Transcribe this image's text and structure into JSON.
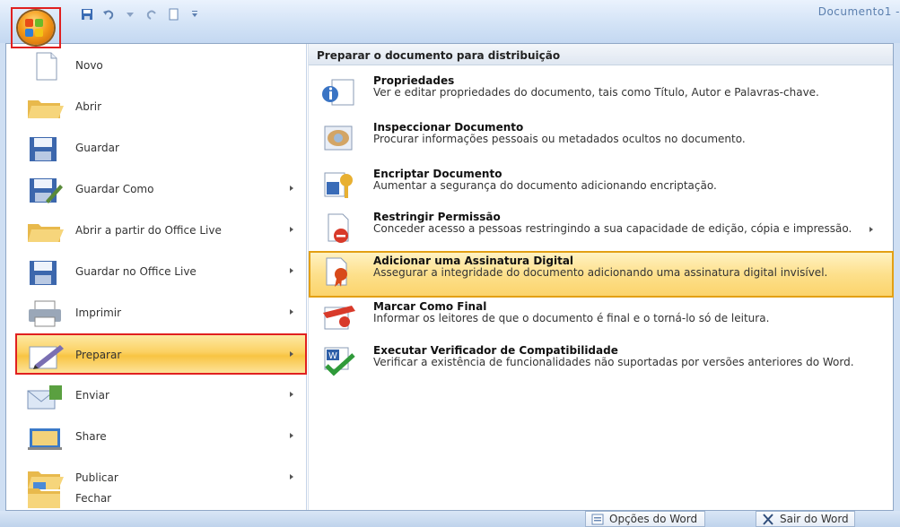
{
  "window": {
    "title": "Documento1 -"
  },
  "left_menu": [
    {
      "label": "Novo",
      "icon": "new-document-icon",
      "submenu": false
    },
    {
      "label": "Abrir",
      "icon": "open-folder-icon",
      "submenu": false
    },
    {
      "label": "Guardar",
      "icon": "save-disk-icon",
      "submenu": false
    },
    {
      "label": "Guardar Como",
      "icon": "save-as-icon",
      "submenu": true
    },
    {
      "label": "Abrir a partir do Office Live",
      "icon": "open-folder-icon",
      "submenu": true
    },
    {
      "label": "Guardar no Office Live",
      "icon": "save-disk-icon",
      "submenu": true
    },
    {
      "label": "Imprimir",
      "icon": "printer-icon",
      "submenu": true
    },
    {
      "label": "Preparar",
      "icon": "prepare-pen-icon",
      "submenu": true,
      "selected": true
    },
    {
      "label": "Enviar",
      "icon": "send-icon",
      "submenu": true
    },
    {
      "label": "Share",
      "icon": "share-icon",
      "submenu": true
    },
    {
      "label": "Publicar",
      "icon": "publish-icon",
      "submenu": true
    },
    {
      "label": "Fechar",
      "icon": "close-folder-icon",
      "submenu": false
    }
  ],
  "right_panel": {
    "heading": "Preparar o documento para distribuição",
    "items": [
      {
        "title": "Propriedades",
        "desc": "Ver e editar propriedades do documento, tais como Título, Autor e Palavras-chave.",
        "icon": "properties-icon"
      },
      {
        "title": "Inspeccionar Documento",
        "desc": "Procurar informações pessoais ou metadados ocultos no documento.",
        "icon": "inspect-icon"
      },
      {
        "title": "Encriptar Documento",
        "desc": "Aumentar a segurança do documento adicionando encriptação.",
        "icon": "encrypt-key-icon"
      },
      {
        "title": "Restringir Permissão",
        "desc": "Conceder acesso a pessoas restringindo a sua capacidade de edição, cópia e impressão.",
        "icon": "restrict-permission-icon",
        "submenu": true
      },
      {
        "title": "Adicionar uma Assinatura Digital",
        "desc": "Assegurar a integridade do documento adicionando uma assinatura digital invisível.",
        "icon": "digital-signature-icon",
        "selected": true
      },
      {
        "title": "Marcar Como Final",
        "desc": "Informar os leitores de que o documento é final e o torná-lo só de leitura.",
        "icon": "mark-final-icon"
      },
      {
        "title": "Executar Verificador de Compatibilidade",
        "desc": "Verificar a existência de funcionalidades não suportadas por versões anteriores do Word.",
        "icon": "compatibility-check-icon"
      }
    ]
  },
  "footer": {
    "options_label": "Opções do Word",
    "exit_label": "Sair do Word"
  },
  "colors": {
    "selection": "#fbd162",
    "selection_border_red": "#e02020",
    "hover_border": "#e3a014",
    "chrome_blue": "#cfdff3"
  }
}
